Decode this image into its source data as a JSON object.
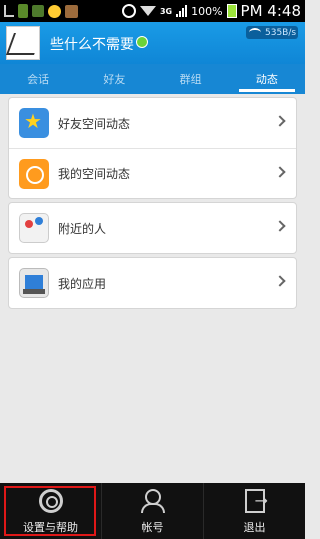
{
  "status_bar": {
    "net_3g": "3G",
    "battery": "100%",
    "time": "PM 4:48"
  },
  "header": {
    "username": "些什么不需要",
    "speed": "535B/s"
  },
  "tabs": [
    {
      "label": "会话"
    },
    {
      "label": "好友"
    },
    {
      "label": "群组"
    },
    {
      "label": "动态",
      "active": true
    }
  ],
  "lists": {
    "feeds": [
      {
        "label": "好友空间动态",
        "icon": "star-feed-icon"
      },
      {
        "label": "我的空间动态",
        "icon": "my-feed-icon"
      }
    ],
    "nearby": {
      "label": "附近的人",
      "icon": "map-pin-icon"
    },
    "apps": {
      "label": "我的应用",
      "icon": "apps-icon"
    }
  },
  "bottom_menu": [
    {
      "label": "设置与帮助",
      "icon": "gear-icon"
    },
    {
      "label": "帐号",
      "icon": "account-icon"
    },
    {
      "label": "退出",
      "icon": "exit-icon"
    }
  ]
}
